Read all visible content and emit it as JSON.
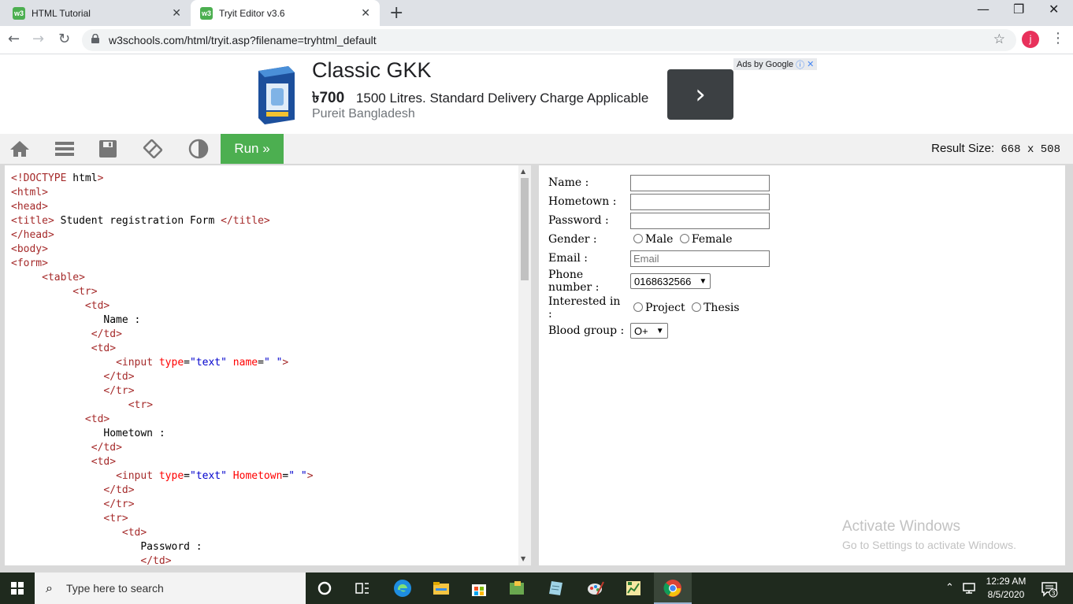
{
  "browser": {
    "tabs": [
      {
        "title": "HTML Tutorial",
        "favicon": "w3"
      },
      {
        "title": "Tryit Editor v3.6",
        "favicon": "w3"
      }
    ],
    "new_tab": "+",
    "url": "w3schools.com/html/tryit.asp?filename=tryhtml_default",
    "avatar_letter": "j"
  },
  "ad": {
    "title": "Classic GKK",
    "price": "৳700",
    "description": "1500 Litres. Standard Delivery Charge Applicable",
    "advertiser": "Pureit Bangladesh",
    "ads_by": "Ads by Google"
  },
  "editor_toolbar": {
    "run_label": "Run »",
    "result_size_label": "Result Size:",
    "result_size_value": "668 x 508"
  },
  "code_lines": [
    "<!DOCTYPE html>",
    "<html>",
    "<head>",
    "<title> Student registration Form </title>",
    "</head>",
    "<body>",
    "<form>",
    "     <table>",
    "          <tr>",
    "            <td>",
    "               Name :",
    "             </td>",
    "             <td>",
    "                 <input type=\"text\" name=\" \">",
    "               </td>",
    "               </tr>",
    "                   <tr>",
    "            <td>",
    "               Hometown :",
    "             </td>",
    "             <td>",
    "                 <input type=\"text\" Hometown=\" \">",
    "               </td>",
    "               </tr>",
    "               <tr>",
    "                  <td>",
    "                     Password :",
    "                     </td>"
  ],
  "form": {
    "name_label": "Name :",
    "hometown_label": "Hometown :",
    "password_label": "Password :",
    "gender_label": "Gender :",
    "gender_male": "Male",
    "gender_female": "Female",
    "email_label": "Email :",
    "email_placeholder": "Email",
    "phone_label": "Phone number :",
    "phone_selected": "0168632566",
    "interest_label": "Interested in :",
    "interest_project": "Project",
    "interest_thesis": "Thesis",
    "blood_label": "Blood group :",
    "blood_selected": "O+"
  },
  "watermark": {
    "line1": "Activate Windows",
    "line2": "Go to Settings to activate Windows."
  },
  "taskbar": {
    "search_placeholder": "Type here to search",
    "time": "12:29 AM",
    "date": "8/5/2020",
    "notifications": "3"
  },
  "colors": {
    "w3_green": "#4caf50",
    "ad_button": "#3c4043",
    "avatar": "#e8315b"
  }
}
